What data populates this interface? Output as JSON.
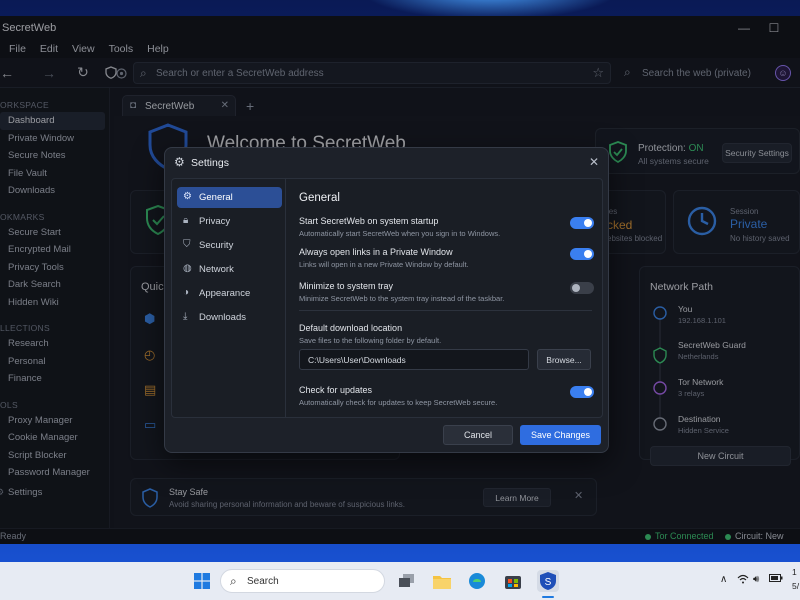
{
  "window": {
    "title": "SecretWeb",
    "maximize_glyph": "☐"
  },
  "menu": [
    "File",
    "Edit",
    "View",
    "Tools",
    "Help"
  ],
  "toolbar": {
    "address_placeholder": "Search or enter a SecretWeb address",
    "search_placeholder": "Search the web (private)"
  },
  "sidebar": {
    "sections": [
      {
        "title": "ORKSPACE",
        "items": [
          "Dashboard",
          "Private Window",
          "Secure Notes",
          "File Vault",
          "Downloads"
        ]
      },
      {
        "title": "OKMARKS",
        "items": [
          "Secure Start",
          "Encrypted Mail",
          "Privacy Tools",
          "Dark Search",
          "Hidden Wiki"
        ]
      },
      {
        "title": "LLECTIONS",
        "items": [
          "Research",
          "Personal",
          "Finance"
        ]
      },
      {
        "title": "OLS",
        "items": [
          "Proxy Manager",
          "Cookie Manager",
          "Script Blocker",
          "Password Manager"
        ]
      }
    ],
    "settings_label": "Settings",
    "active_item": "Dashboard"
  },
  "tabs": [
    {
      "label": "SecretWeb"
    }
  ],
  "dashboard": {
    "welcome": "Welcome to SecretWeb",
    "protection": {
      "label": "Protection:",
      "status": "ON",
      "subtitle": "All systems secure",
      "button": "Security Settings"
    },
    "tracker_card": {
      "label_partial": "ies",
      "value_partial": "cked",
      "sub_partial": "ebsites blocked"
    },
    "session_card": {
      "label": "Session",
      "value": "Private",
      "sub": "No history saved"
    },
    "quick_partial": "Quic",
    "network_path": {
      "title": "Network Path",
      "nodes": [
        {
          "name": "You",
          "detail": "192.168.1.101"
        },
        {
          "name": "SecretWeb Guard",
          "detail": "Netherlands"
        },
        {
          "name": "Tor Network",
          "detail": "3 relays"
        },
        {
          "name": "Destination",
          "detail": "Hidden Service"
        }
      ],
      "button": "New Circuit"
    },
    "tip": {
      "title": "Stay Safe",
      "text": "Avoid sharing personal information and beware of suspicious links.",
      "button": "Learn More"
    }
  },
  "status_bar": {
    "left": "Ready",
    "tor": "Tor Connected",
    "circuit": "Circuit: New"
  },
  "settings_dialog": {
    "title": "Settings",
    "nav": [
      "General",
      "Privacy",
      "Security",
      "Network",
      "Appearance",
      "Downloads"
    ],
    "active_nav": "General",
    "section_title": "General",
    "options": [
      {
        "label": "Start SecretWeb on system startup",
        "desc": "Automatically start SecretWeb when you sign in to Windows.",
        "enabled": true
      },
      {
        "label": "Always open links in a Private Window",
        "desc": "Links will open in a new Private Window by default.",
        "enabled": true
      },
      {
        "label": "Minimize to system tray",
        "desc": "Minimize SecretWeb to the system tray instead of the taskbar.",
        "enabled": false
      }
    ],
    "download": {
      "label": "Default download location",
      "desc": "Save files to the following folder by default.",
      "path": "C:\\Users\\User\\Downloads",
      "browse": "Browse..."
    },
    "updates": {
      "label": "Check for updates",
      "desc": "Automatically check for updates to keep SecretWeb secure.",
      "enabled": true
    },
    "cancel": "Cancel",
    "save": "Save Changes"
  },
  "taskbar": {
    "search_label": "Search",
    "clock_partial": "1",
    "date_partial": "5/"
  },
  "colors": {
    "accent": "#2f6de0",
    "toggle_on": "#3a7ff0",
    "success": "#3fcf78",
    "sidebar_active": "#232a36"
  }
}
